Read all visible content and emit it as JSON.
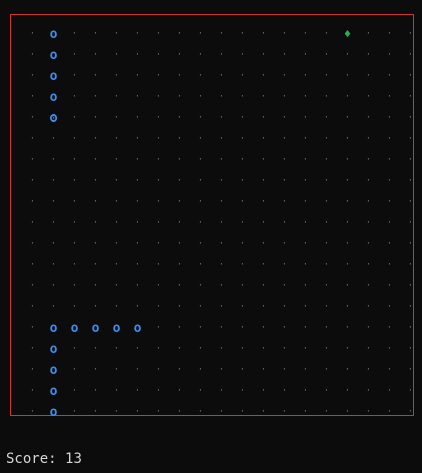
{
  "game": {
    "cols": 18,
    "rows": 18,
    "glyphs": {
      "empty": "·",
      "body": "o",
      "head": "ʘ",
      "food": "♦"
    },
    "colors": {
      "background": "#0c0c0c",
      "border": "#d03535",
      "snake": "#3b8eea",
      "food": "#23b14d",
      "empty_dot": "#6e6e6e",
      "score_text": "#d6d6d6"
    },
    "snake": {
      "head": [
        1,
        4
      ],
      "body": [
        [
          1,
          0
        ],
        [
          1,
          1
        ],
        [
          1,
          2
        ],
        [
          1,
          3
        ],
        [
          1,
          14
        ],
        [
          2,
          14
        ],
        [
          3,
          14
        ],
        [
          4,
          14
        ],
        [
          5,
          14
        ],
        [
          1,
          15
        ],
        [
          1,
          16
        ],
        [
          1,
          17
        ],
        [
          1,
          18
        ]
      ]
    },
    "food": [
      15,
      0
    ]
  },
  "status": {
    "score_label": "Score:",
    "score_value": "13"
  }
}
